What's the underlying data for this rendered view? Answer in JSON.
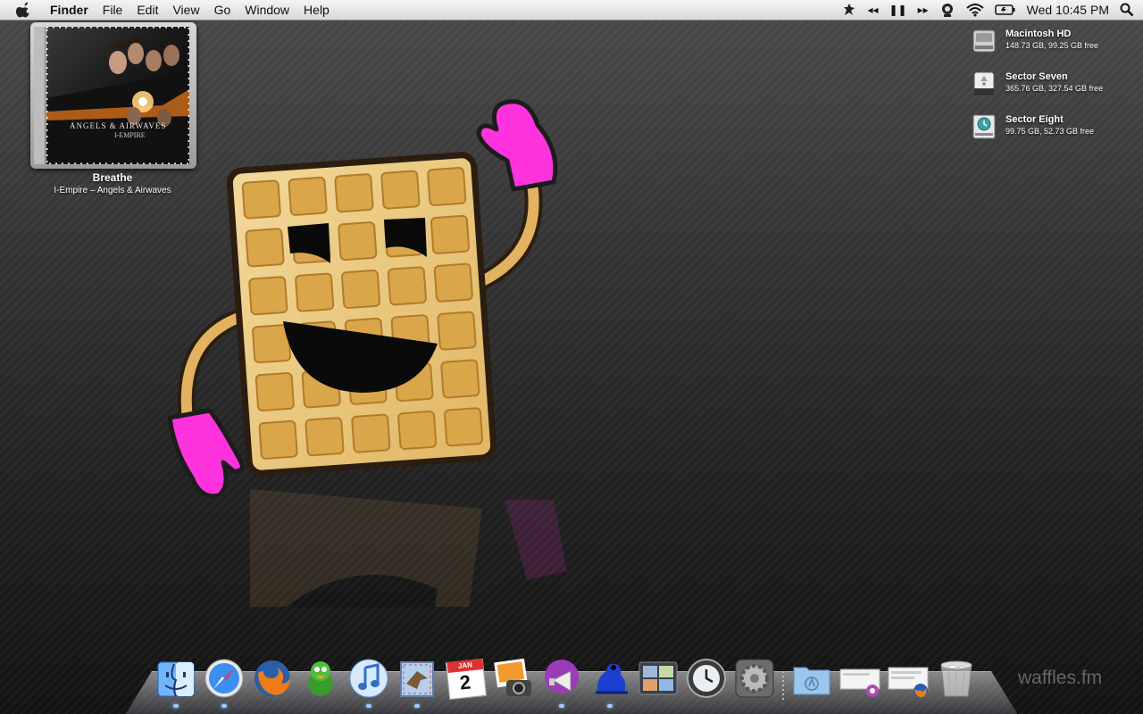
{
  "menubar": {
    "apple_icon": "apple-icon",
    "app_name": "Finder",
    "menus": [
      "File",
      "Edit",
      "View",
      "Go",
      "Window",
      "Help"
    ],
    "status_icons": [
      "growl-icon",
      "itunes-prev-icon",
      "itunes-pause-icon",
      "itunes-next-icon",
      "webcam-icon",
      "wifi-icon",
      "battery-icon"
    ],
    "clock": "Wed 10:45 PM",
    "spotlight_icon": "spotlight-icon"
  },
  "widget": {
    "art_band": "ANGELS & AIRWAVES",
    "art_album": "I-EMPIRE",
    "track": "Breathe",
    "album_artist": "I-Empire – Angels & Airwaves"
  },
  "volumes": [
    {
      "name": "Macintosh HD",
      "info": "148.73 GB, 99.25 GB free",
      "icon": "hard-drive-icon"
    },
    {
      "name": "Sector Seven",
      "info": "365.76 GB, 327.54 GB free",
      "icon": "firewire-drive-icon"
    },
    {
      "name": "Sector Eight",
      "info": "99.75 GB, 52.73 GB free",
      "icon": "time-machine-drive-icon"
    }
  ],
  "dock": {
    "apps": [
      {
        "name": "Finder",
        "icon": "finder-icon",
        "running": true
      },
      {
        "name": "Safari",
        "icon": "safari-icon",
        "running": true
      },
      {
        "name": "Firefox",
        "icon": "firefox-icon",
        "running": false
      },
      {
        "name": "Adium",
        "icon": "adium-icon",
        "running": false
      },
      {
        "name": "iTunes",
        "icon": "itunes-icon",
        "running": true
      },
      {
        "name": "Mail",
        "icon": "mail-icon",
        "running": true
      },
      {
        "name": "iCal",
        "icon": "ical-icon",
        "running": false
      },
      {
        "name": "iPhoto",
        "icon": "iphoto-icon",
        "running": false
      },
      {
        "name": "Hype",
        "icon": "megaphone-icon",
        "running": true
      },
      {
        "name": "Frog",
        "icon": "frog-icon",
        "running": true
      },
      {
        "name": "Spaces",
        "icon": "spaces-icon",
        "running": false
      },
      {
        "name": "Time Machine",
        "icon": "time-machine-icon",
        "running": false
      },
      {
        "name": "System Preferences",
        "icon": "system-preferences-icon",
        "running": false
      }
    ],
    "calendar_month": "JAN",
    "calendar_day": "2",
    "stacks": [
      {
        "name": "Applications",
        "icon": "folder-icon"
      },
      {
        "name": "Downloads",
        "icon": "downloads-stack-icon"
      },
      {
        "name": "Documents",
        "icon": "documents-stack-icon"
      },
      {
        "name": "Trash",
        "icon": "trash-icon"
      }
    ]
  },
  "watermark": "waffles.fm"
}
